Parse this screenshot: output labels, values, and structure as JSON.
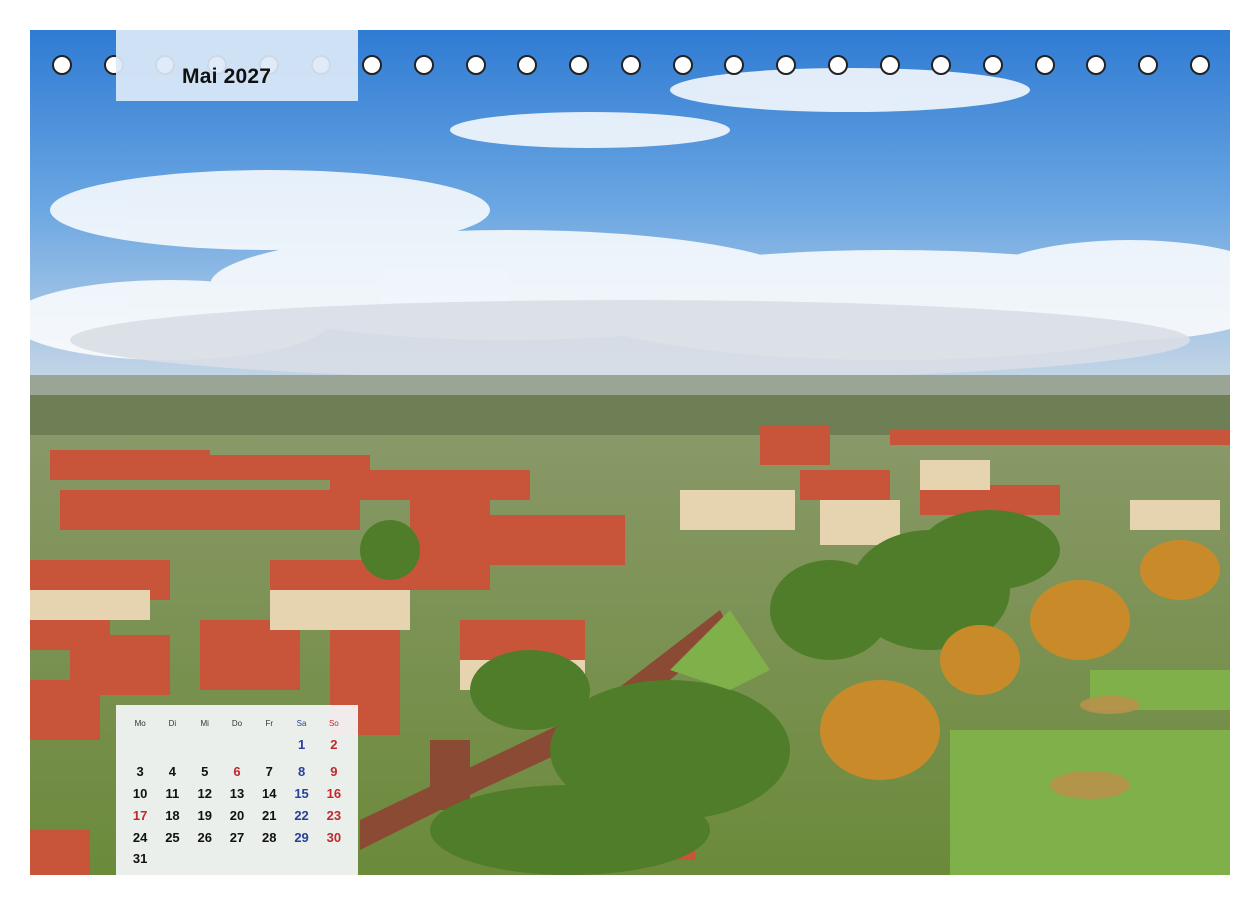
{
  "calendar": {
    "month_title": "Mai 2027",
    "weekdays": [
      "Mo",
      "Di",
      "Mi",
      "Do",
      "Fr",
      "Sa",
      "So"
    ],
    "weeks": [
      [
        "",
        "",
        "",
        "",
        "",
        "1",
        "2"
      ],
      [
        "3",
        "4",
        "5",
        "6",
        "7",
        "8",
        "9"
      ],
      [
        "10",
        "11",
        "12",
        "13",
        "14",
        "15",
        "16"
      ],
      [
        "17",
        "18",
        "19",
        "20",
        "21",
        "22",
        "23"
      ],
      [
        "24",
        "25",
        "26",
        "27",
        "28",
        "29",
        "30"
      ],
      [
        "31",
        "",
        "",
        "",
        "",
        "",
        ""
      ]
    ],
    "holidays_red": [
      "6",
      "17"
    ]
  },
  "colors": {
    "sky": "#3f86d6",
    "roof": "#c8553a",
    "greenery": "#5f8a2c",
    "saturday": "#2a3f9a",
    "sunday": "#c0282d"
  },
  "binding": {
    "hole_count": 23
  }
}
